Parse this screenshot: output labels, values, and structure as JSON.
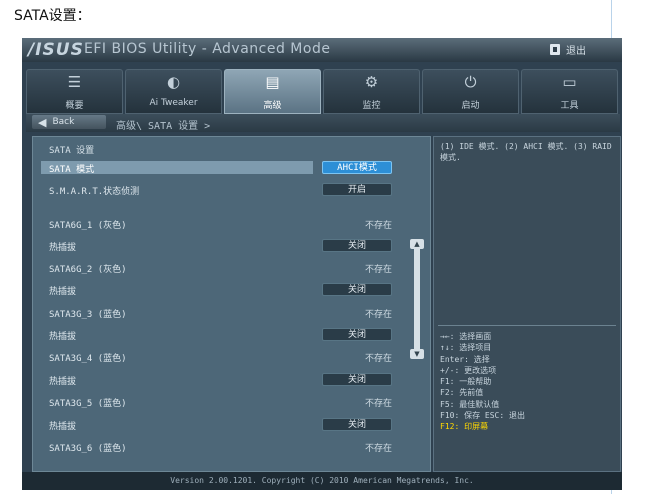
{
  "document": {
    "caption": "SATA设置："
  },
  "bios": {
    "logo": "/ISUS",
    "title": "EFI BIOS Utility - Advanced Mode",
    "exit_label": "退出",
    "tabs": [
      {
        "label": "概要",
        "icon": "list-icon"
      },
      {
        "label": "Ai Tweaker",
        "icon": "tweaker-icon"
      },
      {
        "label": "高级",
        "icon": "advanced-icon",
        "active": true
      },
      {
        "label": "监控",
        "icon": "monitor-icon"
      },
      {
        "label": "启动",
        "icon": "power-icon"
      },
      {
        "label": "工具",
        "icon": "tool-icon"
      }
    ],
    "back_label": "Back",
    "breadcrumb": "高级\\ SATA 设置 >",
    "pane_title": "SATA 设置",
    "rows": [
      {
        "label": "SATA 模式",
        "value": "AHCI模式",
        "selected": true,
        "highlight": true
      },
      {
        "label": "S.M.A.R.T.状态侦测",
        "value": "开启"
      },
      {
        "label": "SATA6G_1 (灰色)",
        "static": "不存在"
      },
      {
        "label": "热插拔",
        "value": "关闭"
      },
      {
        "label": "SATA6G_2 (灰色)",
        "static": "不存在"
      },
      {
        "label": "热插拔",
        "value": "关闭"
      },
      {
        "label": "SATA3G_3 (蓝色)",
        "static": "不存在"
      },
      {
        "label": "热插拔",
        "value": "关闭"
      },
      {
        "label": "SATA3G_4 (蓝色)",
        "static": "不存在"
      },
      {
        "label": "热插拔",
        "value": "关闭"
      },
      {
        "label": "SATA3G_5 (蓝色)",
        "static": "不存在"
      },
      {
        "label": "热插拔",
        "value": "关闭"
      },
      {
        "label": "SATA3G_6 (蓝色)",
        "static": "不存在"
      }
    ],
    "help_text": "(1) IDE 模式. (2) AHCI 模式. (3) RAID 模式.",
    "keys": [
      "→←: 选择画面",
      "↑↓: 选择项目",
      "Enter: 选择",
      "+/-: 更改选项",
      "F1: 一般帮助",
      "F2: 先前值",
      "F5: 最佳默认值",
      "F10: 保存  ESC: 退出",
      "F12: 印屏幕"
    ],
    "footer": "Version 2.00.1201. Copyright (C) 2010 American Megatrends, Inc."
  }
}
